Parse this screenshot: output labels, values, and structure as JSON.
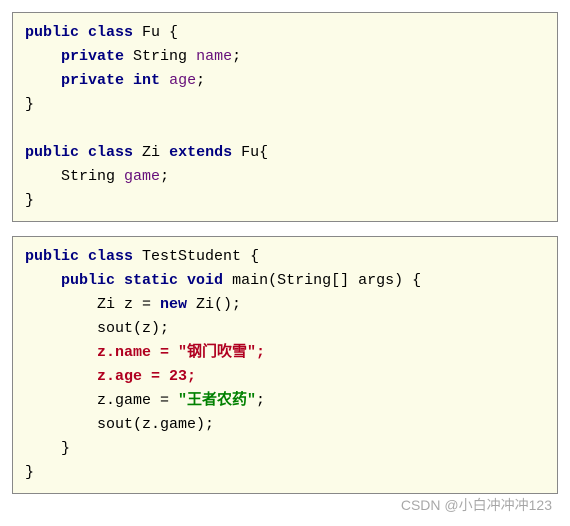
{
  "box1": {
    "l1_kw": "public class",
    "l1_name": "Fu {",
    "l2_kw": "private",
    "l2_type": "String",
    "l2_ident": "name",
    "l2_end": ";",
    "l3_kw": "private int",
    "l3_ident": "age",
    "l3_end": ";",
    "l4": "}",
    "l6_kw": "public class",
    "l6_rest": "Zi",
    "l6_kw2": "extends",
    "l6_rest2": "Fu{",
    "l7_type": "String",
    "l7_ident": "game",
    "l7_end": ";",
    "l8": "}"
  },
  "box2": {
    "l1_kw": "public class",
    "l1_name": "TestStudent {",
    "l2_kw": "public static void",
    "l2_rest": "main(String[] args) {",
    "l3a": "Zi z = ",
    "l3_kw": "new",
    "l3b": " Zi();",
    "l4": "sout(z);",
    "l5_err": "z.name = \"钢门吹雪\";",
    "l6_err": "z.age = 23;",
    "l7a": "z.game = ",
    "l7_str": "\"王者农药\"",
    "l7b": ";",
    "l8": "sout(z.game);",
    "l9": "}",
    "l10": "}"
  },
  "watermark": "CSDN @小白冲冲冲123"
}
